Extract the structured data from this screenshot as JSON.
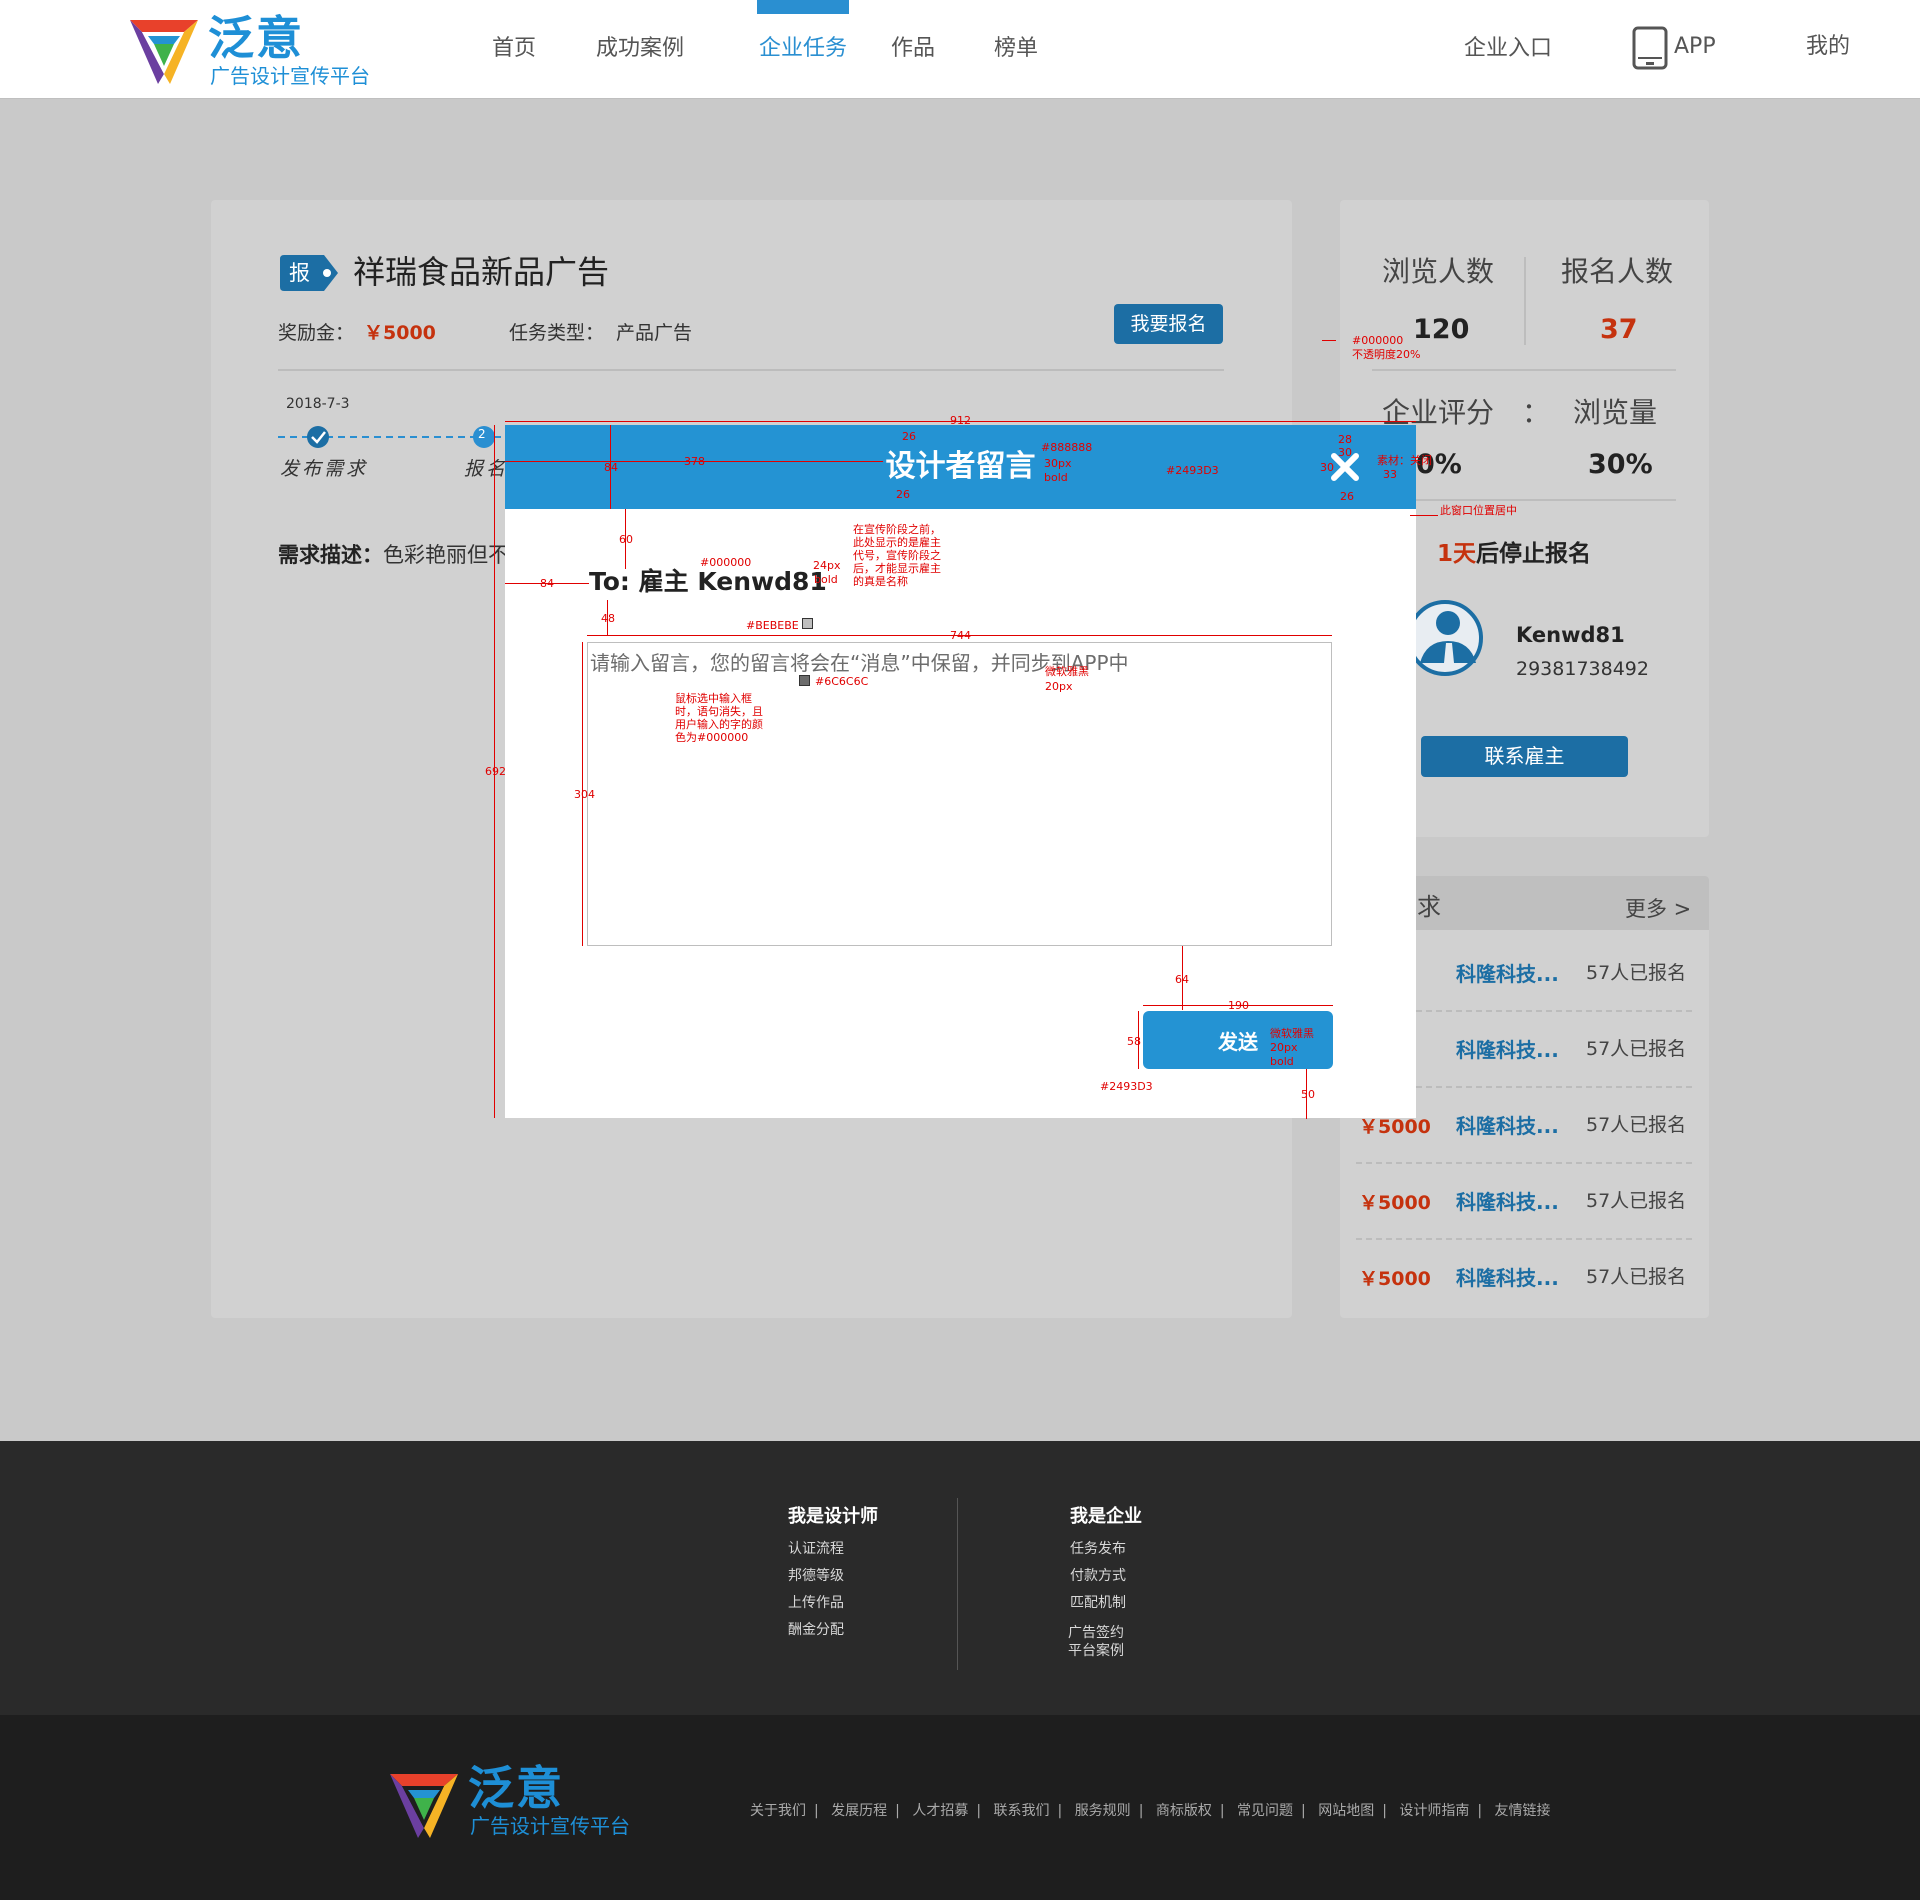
{
  "header": {
    "logo_title": "泛意",
    "logo_sub": "广告设计宣传平台",
    "nav": [
      "首页",
      "成功案例",
      "企业任务",
      "作品",
      "榜单"
    ],
    "right": {
      "enterprise": "企业入口",
      "app": "APP",
      "mine": "我的"
    }
  },
  "task": {
    "tag": "报",
    "title": "祥瑞食品新品广告",
    "reward_label": "奖励金：",
    "reward_value": "￥5000",
    "type_label": "任务类型：",
    "type_value": "产品广告",
    "signup_button": "我要报名",
    "timeline_date": "2018-7-3",
    "timeline_step2": "2",
    "timeline_labels": [
      "发布需求",
      "报名"
    ],
    "requirement_label": "需求描述：",
    "requirement_text": "色彩艳丽但不"
  },
  "side": {
    "views_label": "浏览人数",
    "views_value": "120",
    "signups_label": "报名人数",
    "signups_value": "37",
    "rating_label": "企业评分",
    "rating_colon": "：",
    "rating_value": "0%",
    "pageviews_label": "浏览量",
    "pageviews_value": "30%",
    "countdown_days": "1天",
    "countdown_text": "后停止报名",
    "employer_name": "Kenwd81",
    "employer_phone": "29381738492",
    "contact_button": "联系雇主"
  },
  "list": {
    "title": "需求",
    "more": "更多 >",
    "rows": [
      {
        "price": "0",
        "company": "科隆科技...",
        "count": "57人已报名"
      },
      {
        "price": "0",
        "company": "科隆科技...",
        "count": "57人已报名"
      },
      {
        "price": "￥5000",
        "company": "科隆科技...",
        "count": "57人已报名"
      },
      {
        "price": "￥5000",
        "company": "科隆科技...",
        "count": "57人已报名"
      },
      {
        "price": "￥5000",
        "company": "科隆科技...",
        "count": "57人已报名"
      }
    ]
  },
  "modal": {
    "title": "设计者留言",
    "to": "To: 雇主 Kenwd81",
    "placeholder": "请输入留言，您的留言将会在“消息”中保留，并同步到APP中",
    "send": "发送"
  },
  "annotations": {
    "overlay_color": "#000000",
    "overlay_opacity": "不透明度20%",
    "modal_width": "912",
    "bar_height": "84",
    "title_offset": "378",
    "title_color": "#888888",
    "title_font": "30px",
    "title_weight": "bold",
    "bar_color": "#2493D3",
    "close_top": "28",
    "close_size_a": "30",
    "close_size_b": "30",
    "close_size_c": "33",
    "close_bottom": "26",
    "close_label": "素材：关闭",
    "top_gap": "26",
    "bottom_gap": "26",
    "centered": "此窗口位置居中",
    "to_gap": "60",
    "to_left": "84",
    "to_color": "#000000",
    "to_font": "24px",
    "to_weight": "bold",
    "to_note": "在宣传阶段之前，此处显示的是雇主代号，宣传阶段之后，才能显示雇主的真是名称",
    "box_gap": "48",
    "border_color": "#BEBEBE",
    "box_width": "744",
    "placeholder_color": "#6C6C6C",
    "placeholder_font": "微软雅黑",
    "placeholder_size": "20px",
    "focus_note": "鼠标选中输入框时，语句消失，且用户输入的字的颜色为#000000",
    "modal_height": "692",
    "box_height": "304",
    "send_gap": "64",
    "send_width": "190",
    "send_height": "58",
    "send_font": "微软雅黑",
    "send_size": "20px",
    "send_weight": "bold",
    "send_color": "#2493D3",
    "send_bottom": "50"
  },
  "footer": {
    "designer_title": "我是设计师",
    "designer_links": [
      "认证流程",
      "邦德等级",
      "上传作品",
      "酬金分配"
    ],
    "enterprise_title": "我是企业",
    "enterprise_links": [
      "任务发布",
      "付款方式",
      "匹配机制",
      "广告签约",
      "平台案例"
    ],
    "bottom_links": [
      "关于我们",
      "发展历程",
      "人才招募",
      "联系我们",
      "服务规则",
      "商标版权",
      "常见问题",
      "网站地图",
      "设计师指南",
      "友情链接"
    ],
    "logo_title": "泛意",
    "logo_sub": "广告设计宣传平台"
  },
  "colors": {
    "brand": "#2493d3",
    "dark_button": "#1c6ea4",
    "price": "#c5320e",
    "annotation": "#e00000"
  }
}
